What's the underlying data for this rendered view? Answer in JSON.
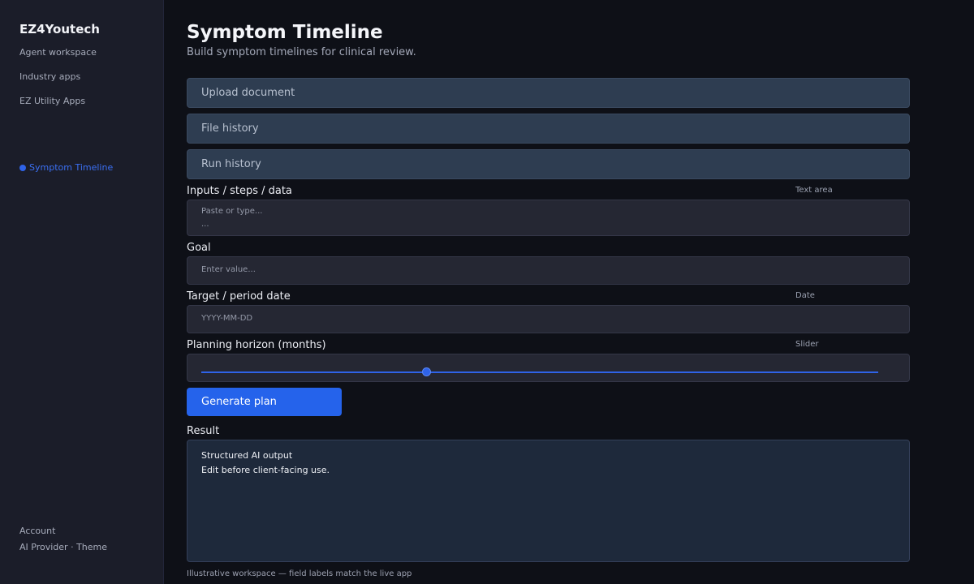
{
  "sidebar": {
    "brand": "EZ4Youtech",
    "nav": [
      "Agent workspace",
      "Industry apps",
      "EZ Utility Apps"
    ],
    "active_item": "Symptom Timeline",
    "footer": {
      "account": "Account",
      "provider": "AI Provider",
      "separator": "·",
      "theme": "Theme"
    }
  },
  "header": {
    "title": "Symptom Timeline",
    "subtitle": "Build symptom timelines for clinical review."
  },
  "sections": {
    "upload": "Upload document",
    "file_history": "File history",
    "run_history": "Run history"
  },
  "fields": {
    "inputs": {
      "label": "Inputs / steps / data",
      "type": "Text area",
      "placeholder": "Paste or type...",
      "placeholder_line2": "..."
    },
    "goal": {
      "label": "Goal",
      "placeholder": "Enter value..."
    },
    "target_date": {
      "label": "Target / period date",
      "type": "Date",
      "placeholder": "YYYY-MM-DD"
    },
    "horizon": {
      "label": "Planning horizon (months)",
      "type": "Slider",
      "level": 0.333
    }
  },
  "actions": {
    "generate": "Generate plan"
  },
  "result": {
    "label": "Result",
    "line1": "Structured AI output",
    "line2": "Edit before client-facing use."
  },
  "footnote": "Illustrative workspace — field labels match the live app",
  "colors": {
    "accent": "#2563eb",
    "sidebar_bg": "#1b1d29",
    "page_bg": "#0e1017",
    "collapsible_bg": "#2e3d51",
    "input_bg": "#252733",
    "result_bg": "#1e293b"
  }
}
